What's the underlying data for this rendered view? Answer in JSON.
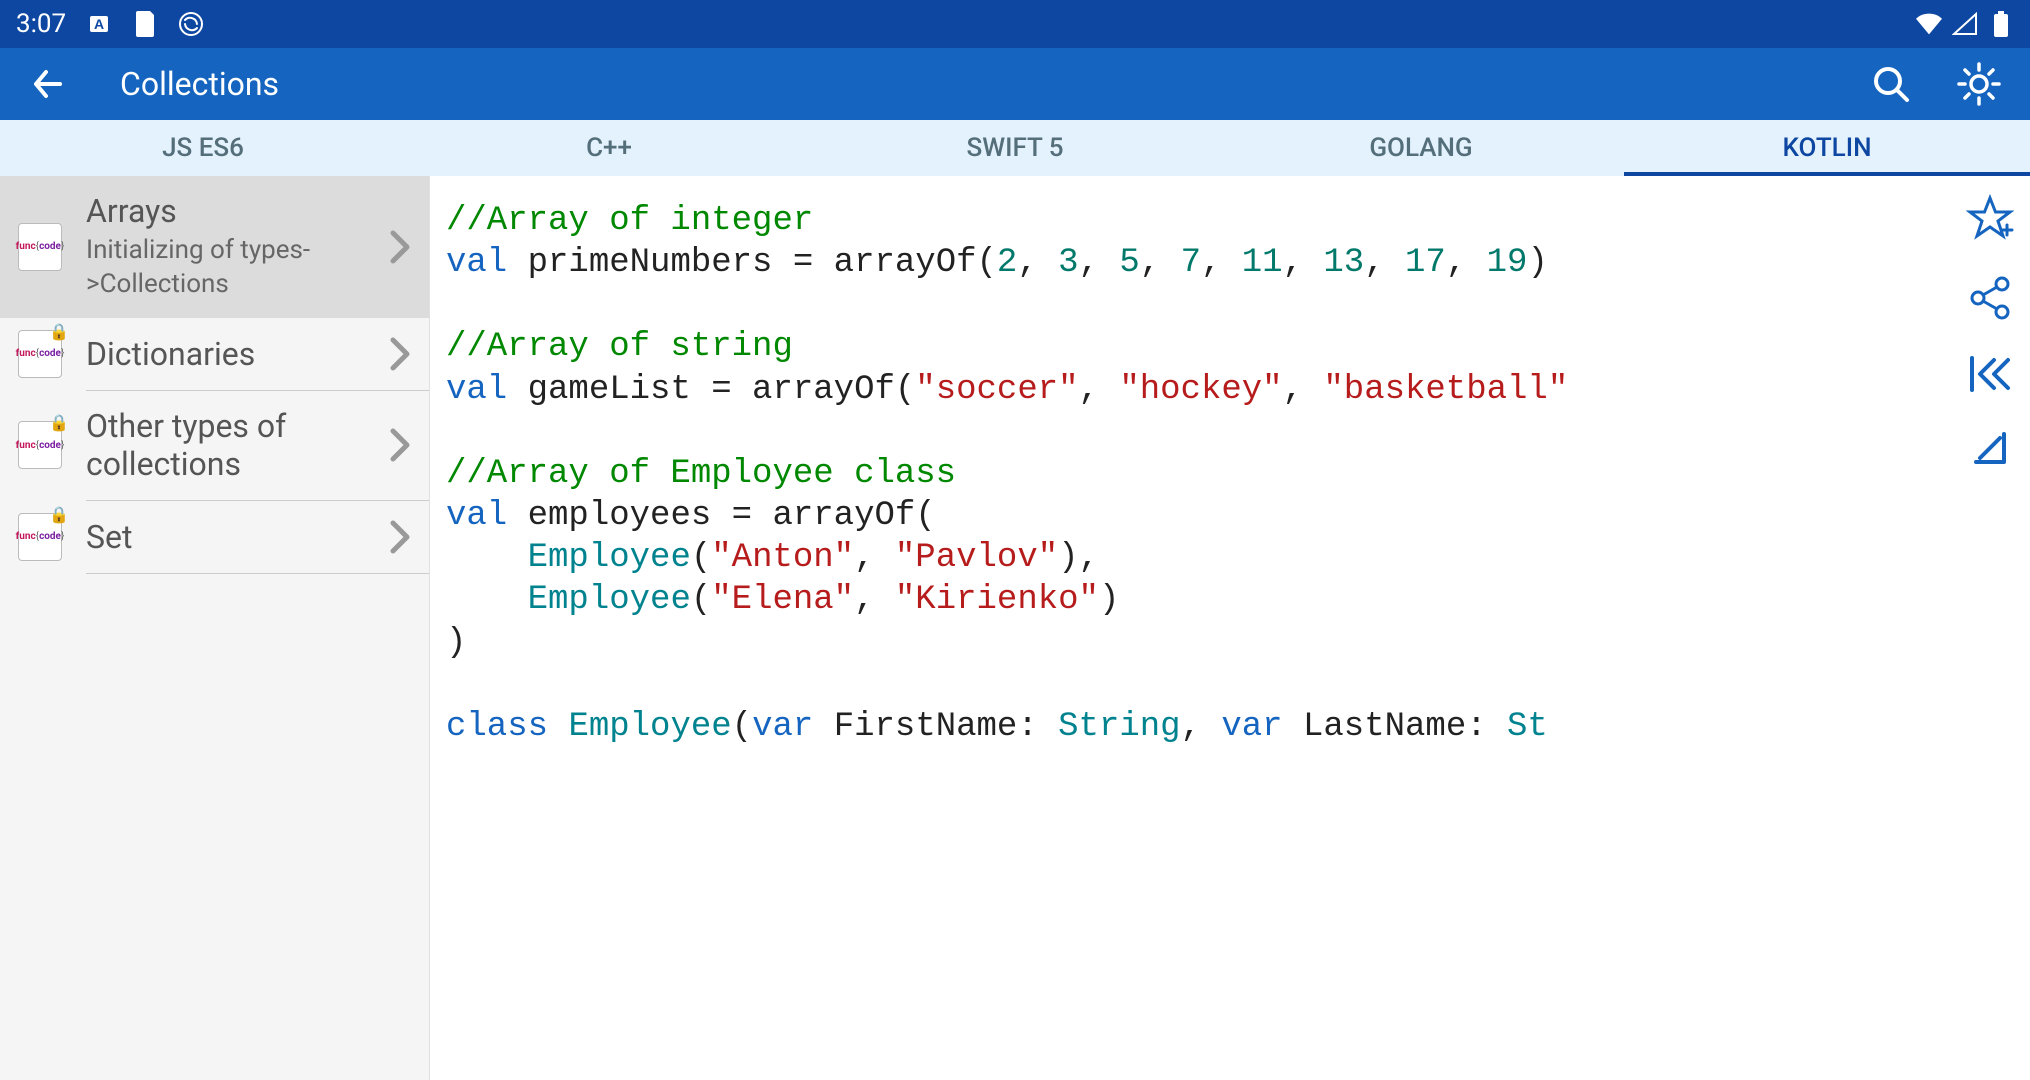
{
  "status": {
    "time": "3:07"
  },
  "appbar": {
    "title": "Collections"
  },
  "tabs": [
    {
      "label": "JS ES6",
      "active": false
    },
    {
      "label": "C++",
      "active": false
    },
    {
      "label": "SWIFT 5",
      "active": false
    },
    {
      "label": "GOLANG",
      "active": false
    },
    {
      "label": "KOTLIN",
      "active": true
    }
  ],
  "sidebar": [
    {
      "title": "Arrays",
      "subtitle": "Initializing of types->Collections",
      "locked": false,
      "selected": true
    },
    {
      "title": "Dictionaries",
      "subtitle": "",
      "locked": true,
      "selected": false
    },
    {
      "title": "Other types of collections",
      "subtitle": "",
      "locked": true,
      "selected": false
    },
    {
      "title": "Set",
      "subtitle": "",
      "locked": true,
      "selected": false
    }
  ],
  "code": {
    "lines": [
      {
        "tokens": [
          {
            "cls": "tok-comment",
            "text": "//Array of integer"
          }
        ]
      },
      {
        "tokens": [
          {
            "cls": "tok-keyword",
            "text": "val"
          },
          {
            "cls": "",
            "text": " primeNumbers = arrayOf("
          },
          {
            "cls": "tok-number",
            "text": "2"
          },
          {
            "cls": "",
            "text": ", "
          },
          {
            "cls": "tok-number",
            "text": "3"
          },
          {
            "cls": "",
            "text": ", "
          },
          {
            "cls": "tok-number",
            "text": "5"
          },
          {
            "cls": "",
            "text": ", "
          },
          {
            "cls": "tok-number",
            "text": "7"
          },
          {
            "cls": "",
            "text": ", "
          },
          {
            "cls": "tok-number",
            "text": "11"
          },
          {
            "cls": "",
            "text": ", "
          },
          {
            "cls": "tok-number",
            "text": "13"
          },
          {
            "cls": "",
            "text": ", "
          },
          {
            "cls": "tok-number",
            "text": "17"
          },
          {
            "cls": "",
            "text": ", "
          },
          {
            "cls": "tok-number",
            "text": "19"
          },
          {
            "cls": "",
            "text": ")"
          }
        ]
      },
      {
        "tokens": [
          {
            "cls": "",
            "text": ""
          }
        ]
      },
      {
        "tokens": [
          {
            "cls": "tok-comment",
            "text": "//Array of string"
          }
        ]
      },
      {
        "tokens": [
          {
            "cls": "tok-keyword",
            "text": "val"
          },
          {
            "cls": "",
            "text": " gameList = arrayOf("
          },
          {
            "cls": "tok-string",
            "text": "\"soccer\""
          },
          {
            "cls": "",
            "text": ", "
          },
          {
            "cls": "tok-string",
            "text": "\"hockey\""
          },
          {
            "cls": "",
            "text": ", "
          },
          {
            "cls": "tok-string",
            "text": "\"basketball\""
          }
        ]
      },
      {
        "tokens": [
          {
            "cls": "",
            "text": ""
          }
        ]
      },
      {
        "tokens": [
          {
            "cls": "tok-comment",
            "text": "//Array of Employee class"
          }
        ]
      },
      {
        "tokens": [
          {
            "cls": "tok-keyword",
            "text": "val"
          },
          {
            "cls": "",
            "text": " employees = arrayOf("
          }
        ]
      },
      {
        "tokens": [
          {
            "cls": "",
            "text": "    "
          },
          {
            "cls": "tok-type",
            "text": "Employee"
          },
          {
            "cls": "",
            "text": "("
          },
          {
            "cls": "tok-string",
            "text": "\"Anton\""
          },
          {
            "cls": "",
            "text": ", "
          },
          {
            "cls": "tok-string",
            "text": "\"Pavlov\""
          },
          {
            "cls": "",
            "text": "),"
          }
        ]
      },
      {
        "tokens": [
          {
            "cls": "",
            "text": "    "
          },
          {
            "cls": "tok-type",
            "text": "Employee"
          },
          {
            "cls": "",
            "text": "("
          },
          {
            "cls": "tok-string",
            "text": "\"Elena\""
          },
          {
            "cls": "",
            "text": ", "
          },
          {
            "cls": "tok-string",
            "text": "\"Kirienko\""
          },
          {
            "cls": "",
            "text": ")"
          }
        ]
      },
      {
        "tokens": [
          {
            "cls": "",
            "text": ")"
          }
        ]
      },
      {
        "tokens": [
          {
            "cls": "",
            "text": ""
          }
        ]
      },
      {
        "tokens": [
          {
            "cls": "tok-keyword",
            "text": "class"
          },
          {
            "cls": "",
            "text": " "
          },
          {
            "cls": "tok-type",
            "text": "Employee"
          },
          {
            "cls": "",
            "text": "("
          },
          {
            "cls": "tok-keyword",
            "text": "var"
          },
          {
            "cls": "",
            "text": " FirstName: "
          },
          {
            "cls": "tok-type",
            "text": "String"
          },
          {
            "cls": "",
            "text": ", "
          },
          {
            "cls": "tok-keyword",
            "text": "var"
          },
          {
            "cls": "",
            "text": " LastName: "
          },
          {
            "cls": "tok-type",
            "text": "St"
          }
        ]
      }
    ]
  }
}
